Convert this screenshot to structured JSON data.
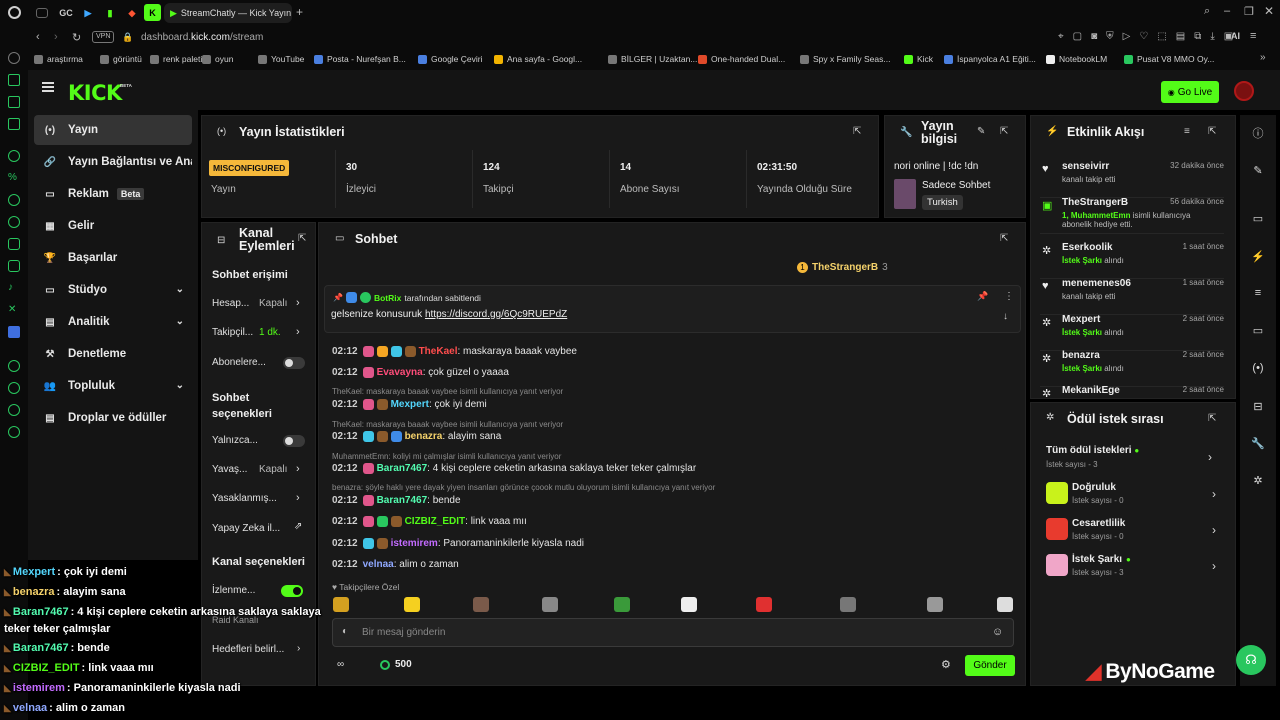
{
  "browser": {
    "tab_title": "StreamChatly — Kick Yayın",
    "url_prefix": "dashboard.",
    "url_domain": "kick.com",
    "url_path": "/stream",
    "vpn": "VPN",
    "ai": "AI",
    "tab_gc": "GC",
    "bookmarks": [
      {
        "label": "araştırma",
        "color": "#777"
      },
      {
        "label": "görüntü",
        "color": "#777"
      },
      {
        "label": "renk paleti",
        "color": "#777"
      },
      {
        "label": "oyun",
        "color": "#777"
      },
      {
        "label": "YouTube",
        "color": "#777"
      },
      {
        "label": "Posta - Nurefşan B...",
        "color": "#4a7fe0"
      },
      {
        "label": "Google Çeviri",
        "color": "#4a7fe0"
      },
      {
        "label": "Ana sayfa - Googl...",
        "color": "#f3b400"
      },
      {
        "label": "BİLGER | Uzaktan...",
        "color": "#777"
      },
      {
        "label": "One-handed Dual...",
        "color": "#e04a2a"
      },
      {
        "label": "Spy x Family Seas...",
        "color": "#777"
      },
      {
        "label": "Kick",
        "color": "#53fc18"
      },
      {
        "label": "İspanyolca A1 Eğiti...",
        "color": "#4a7fe0"
      },
      {
        "label": "NotebookLM",
        "color": "#eee"
      },
      {
        "label": "Pusat V8 MMO Oy...",
        "color": "#29c75f"
      }
    ]
  },
  "header": {
    "logo": "KICK",
    "logo_beta": "BETA",
    "go_live": "Go Live"
  },
  "sidebar": {
    "items": [
      {
        "label": "Yayın",
        "icon": "broadcast-icon",
        "glyph": "(•)"
      },
      {
        "label": "Yayın Bağlantısı ve Anahtar",
        "icon": "link-icon",
        "glyph": "🔗"
      },
      {
        "label": "Reklam",
        "icon": "ad-icon",
        "glyph": "▭",
        "badge": "Beta"
      },
      {
        "label": "Gelir",
        "icon": "revenue-icon",
        "glyph": "▦"
      },
      {
        "label": "Başarılar",
        "icon": "trophy-icon",
        "glyph": "🏆"
      },
      {
        "label": "Stüdyo",
        "icon": "studio-icon",
        "glyph": "▭"
      },
      {
        "label": "Analitik",
        "icon": "analytics-icon",
        "glyph": "▤"
      },
      {
        "label": "Denetleme",
        "icon": "hammer-icon",
        "glyph": "⚒"
      },
      {
        "label": "Topluluk",
        "icon": "community-icon",
        "glyph": "👥"
      },
      {
        "label": "Droplar ve ödüller",
        "icon": "gift-icon",
        "glyph": "▤"
      }
    ]
  },
  "stats": {
    "title": "Yayın İstatistikleri",
    "misconfigured": "MISCONFIGURED",
    "cells": [
      {
        "value": "",
        "label": "Yayın"
      },
      {
        "value": "30",
        "label": "İzleyici"
      },
      {
        "value": "124",
        "label": "Takipçi"
      },
      {
        "value": "14",
        "label": "Abone Sayısı"
      },
      {
        "value": "02:31:50",
        "label": "Yayında Olduğu Süre"
      }
    ]
  },
  "stream_info": {
    "title_line1": "Yayın",
    "title_line2": "bilgisi",
    "stream_title": "nori online | !dc !dn",
    "category": "Sadece Sohbet",
    "language": "Turkish"
  },
  "channel_actions": {
    "title_line1": "Kanal",
    "title_line2": "Eylemleri",
    "chat_access_heading": "Sohbet erişimi",
    "rows1": [
      {
        "label": "Hesap...",
        "value": "Kapalı"
      },
      {
        "label": "Takipçil...",
        "value": "1 dk."
      }
    ],
    "subscribers_label": "Abonelere...",
    "chat_options_line1": "Sohbet",
    "chat_options_line2": "seçenekleri",
    "only_label": "Yalnızca...",
    "rows2": [
      {
        "label": "Yavaş...",
        "value": "Kapalı"
      },
      {
        "label": "Yasaklanmış...",
        "value": ""
      }
    ],
    "ai_label": "Yapay Zeka il...",
    "channel_options_heading": "Kanal seçenekleri",
    "watch_label": "İzlenme...",
    "raid_label": "Raid Kanalı",
    "targets_label": "Hedefleri belirl..."
  },
  "chat": {
    "title": "Sohbet",
    "top_user": "TheStrangerB",
    "top_count": "3",
    "pinned_by_user": "BotRix",
    "pinned_by_text": "tarafından sabitlendi",
    "pinned_text": "gelsenize konusuruk",
    "pinned_link": "https://discord.gg/6Qc9RUEPdZ",
    "messages": [
      {
        "type": "msg",
        "time": "02:12",
        "user": "TheKael",
        "color": "#ff4d4d",
        "text": ": maskaraya baaak vaybee",
        "badges": [
          "#e0568b",
          "#f5a623",
          "#3fc6e8",
          "#8b5a2b"
        ]
      },
      {
        "type": "msg",
        "time": "02:12",
        "user": "Evavayna",
        "color": "#ff4d7a",
        "text": ": çok güzel o yaaaa",
        "badges": [
          "#e0568b"
        ]
      },
      {
        "type": "reply",
        "text": "TheKael: maskaraya baaak vaybee isimli kullanıcıya yanıt veriyor"
      },
      {
        "type": "msg",
        "time": "02:12",
        "user": "Mexpert",
        "color": "#53d6fc",
        "text": ": çok iyi demi",
        "badges": [
          "#e0568b",
          "#8b5a2b"
        ]
      },
      {
        "type": "reply",
        "text": "TheKael: maskaraya baaak vaybee isimli kullanıcıya yanıt veriyor"
      },
      {
        "type": "msg",
        "time": "02:12",
        "user": "benazra",
        "color": "#f5d26b",
        "text": ": alayim sana",
        "badges": [
          "#3fc6e8",
          "#8b5a2b",
          "#3f8be8"
        ]
      },
      {
        "type": "reply",
        "text": "MuhammetEmn: koliyi mi çalmışlar isimli kullanıcıya yanıt veriyor"
      },
      {
        "type": "msg",
        "time": "02:12",
        "user": "Baran7467",
        "color": "#53fcb0",
        "text": ": 4 kişi ceplere ceketin arkasına saklaya teker teker çalmışlar",
        "badges": [
          "#e0568b"
        ]
      },
      {
        "type": "reply",
        "text": "benazra: şöyle haklı yere dayak yiyen insanları görünce çoook mutlu oluyorum isimli kullanıcıya yanıt veriyor"
      },
      {
        "type": "msg",
        "time": "02:12",
        "user": "Baran7467",
        "color": "#53fcb0",
        "text": ": bende",
        "badges": [
          "#e0568b"
        ]
      },
      {
        "type": "msg",
        "time": "02:12",
        "user": "CIZBIZ_EDIT",
        "color": "#53fc18",
        "text": ": link vaaa mıı",
        "badges": [
          "#e0568b",
          "#29c75f",
          "#8b5a2b"
        ]
      },
      {
        "type": "msg",
        "time": "02:12",
        "user": "istemirem",
        "color": "#c36bff",
        "text": ": Panoramaninkilerle kiyasla nadi",
        "badges": [
          "#3fc6e8",
          "#8b5a2b"
        ]
      },
      {
        "type": "msg",
        "time": "02:12",
        "user": "velnaa",
        "color": "#8fa8ff",
        "text": ": alim o zaman",
        "badges": []
      }
    ],
    "followers_only": "Takipçilere Özel",
    "input_placeholder": "Bir mesaj gönderin",
    "points": "500",
    "send": "Gönder"
  },
  "activity": {
    "title": "Etkinlik Akışı",
    "events": [
      {
        "name": "senseivirr",
        "sub": "kanalı takip etti",
        "time": "32 dakika önce",
        "icon": "heart-icon",
        "sub2": ""
      },
      {
        "name": "TheStrangerB",
        "sub": "1, MuhammetEmn",
        "sub_rest": " isimli kullanıcıya",
        "sub2": "abonelik hediye etti.",
        "time": "56 dakika önce",
        "icon": "gift-icon"
      },
      {
        "name": "Eserkoolik",
        "sub": "İstek Şarkı",
        "sub_rest": " alındı",
        "time": "1 saat önce",
        "icon": "reward-icon",
        "sub2": ""
      },
      {
        "name": "menemenes06",
        "sub": "kanalı takip etti",
        "time": "1 saat önce",
        "icon": "heart-icon",
        "sub2": ""
      },
      {
        "name": "Mexpert",
        "sub": "İstek Şarkı",
        "sub_rest": " alındı",
        "time": "2 saat önce",
        "icon": "reward-icon",
        "sub2": ""
      },
      {
        "name": "benazra",
        "sub": "İstek Şarkı",
        "sub_rest": " alındı",
        "time": "2 saat önce",
        "icon": "reward-icon",
        "sub2": ""
      },
      {
        "name": "MekanikEge",
        "sub": "",
        "time": "2 saat önce",
        "icon": "reward-icon",
        "sub2": ""
      }
    ]
  },
  "rewards": {
    "title": "Ödül istek sırası",
    "all_label": "Tüm ödül istekleri",
    "all_count": "İstek sayısı - 3",
    "items": [
      {
        "name": "Doğruluk",
        "count": "İstek sayısı - 0",
        "color": "#c9f21b"
      },
      {
        "name": "Cesaretlilik",
        "count": "İstek sayısı - 0",
        "color": "#e83b2e"
      },
      {
        "name": "İstek Şarkı",
        "count": "İstek sayısı - 3",
        "color": "#f0a6c8"
      }
    ]
  },
  "watermark": "ByNoGame",
  "overlay": [
    {
      "user": "Mexpert",
      "color": "#53d6fc",
      "text": " : çok iyi demi"
    },
    {
      "user": "benazra",
      "color": "#f5d26b",
      "text": " : alayim sana"
    },
    {
      "user": "Baran7467",
      "color": "#53fcb0",
      "text": " : 4 kişi ceplere ceketin arkasına saklaya saklaya"
    },
    {
      "user": "",
      "color": "#fff",
      "text": "teker teker çalmışlar"
    },
    {
      "user": "Baran7467",
      "color": "#53fcb0",
      "text": " : bende"
    },
    {
      "user": "CIZBIZ_EDIT",
      "color": "#53fc18",
      "text": " : link vaaa mıı"
    },
    {
      "user": "istemirem",
      "color": "#c36bff",
      "text": " : Panoramaninkilerle kiyasla nadi"
    },
    {
      "user": "velnaa",
      "color": "#8fa8ff",
      "text": " : alim o zaman"
    }
  ],
  "colors": {
    "accent": "#53fc18",
    "misconfigured": "#f5b83a"
  }
}
